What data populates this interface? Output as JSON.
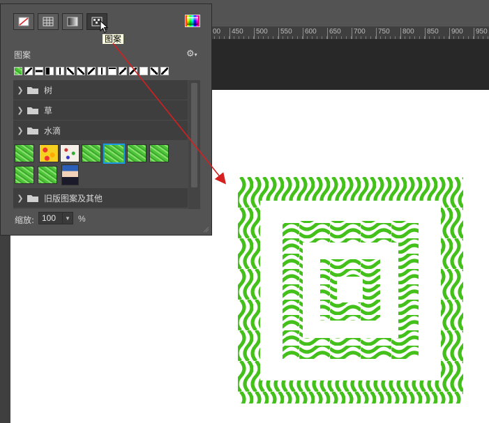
{
  "ruler": {
    "ticks": [
      "00",
      "450",
      "500",
      "550",
      "600",
      "650",
      "700",
      "750",
      "800",
      "850",
      "900",
      "950"
    ]
  },
  "panel": {
    "fill_types": [
      {
        "name": "none",
        "icon": "no-fill-icon"
      },
      {
        "name": "solid",
        "icon": "grid-icon"
      },
      {
        "name": "gradient",
        "icon": "gradient-icon"
      },
      {
        "name": "pattern",
        "icon": "pattern-icon",
        "active": true
      }
    ],
    "tooltip": "图案",
    "section_label": "图案",
    "gear_icon": "gear-icon",
    "groups": [
      {
        "label": "树"
      },
      {
        "label": "草"
      },
      {
        "label": "水滴"
      },
      {
        "label": "旧版图案及其他"
      }
    ],
    "selected_tile_index": 4,
    "scale_label": "缩放:",
    "scale_value": "100",
    "scale_unit": "%"
  },
  "colors": {
    "accent": "#1a9be6",
    "pattern_green": "#44c01a",
    "arrow": "#d42020"
  }
}
